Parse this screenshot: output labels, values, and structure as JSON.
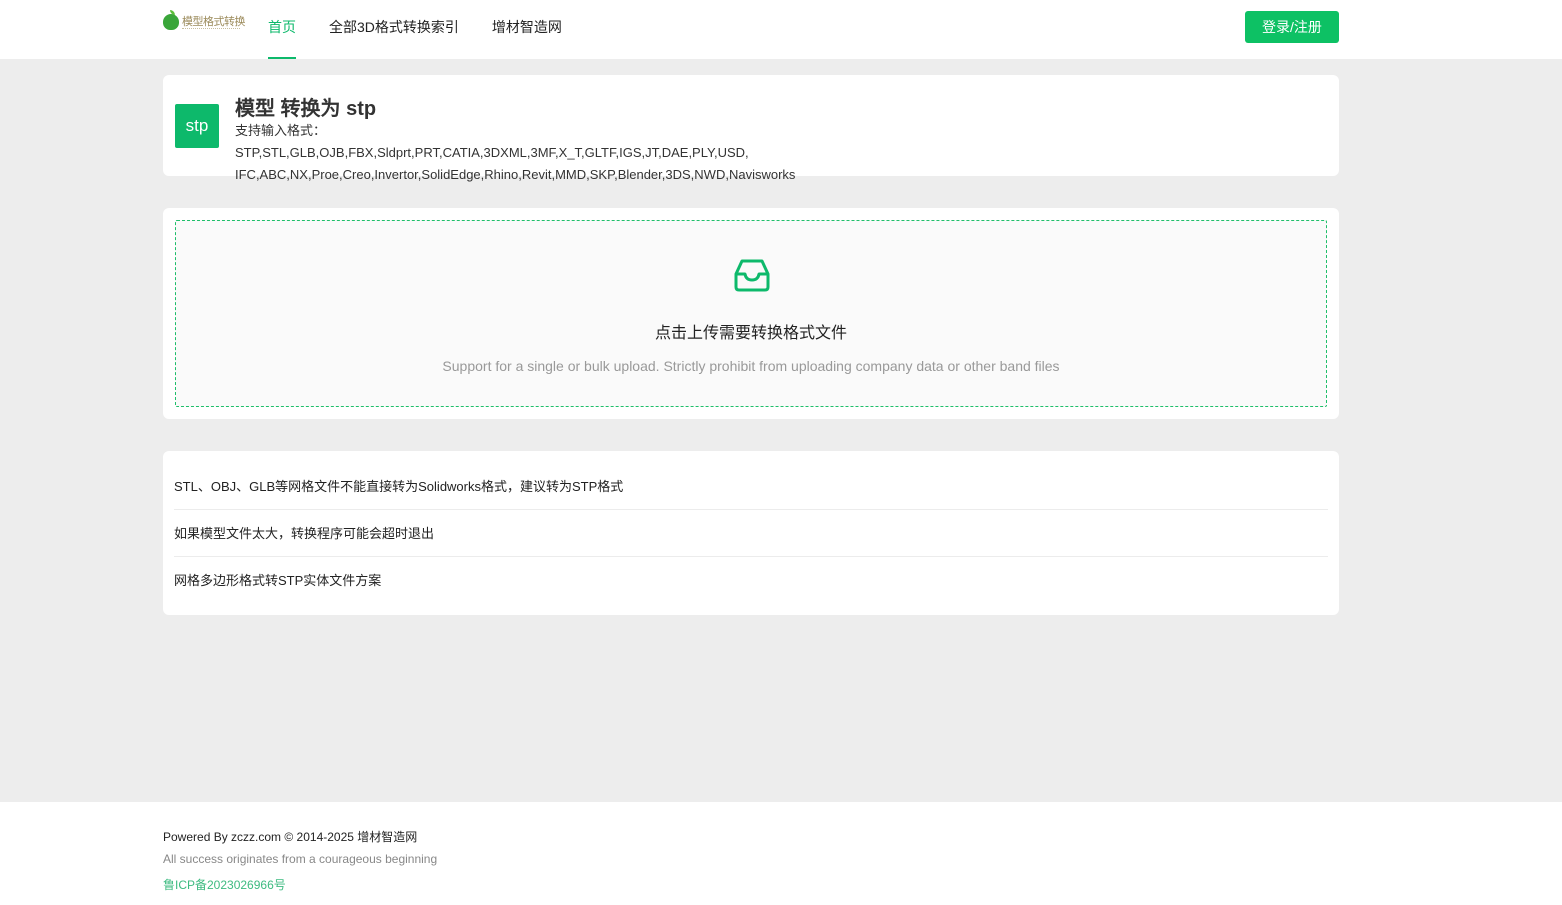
{
  "brand": {
    "logo_text": "模型格式转换"
  },
  "nav": {
    "items": [
      {
        "label": "首页",
        "active": true
      },
      {
        "label": "全部3D格式转换索引",
        "active": false
      },
      {
        "label": "增材智造网",
        "active": false
      }
    ]
  },
  "auth": {
    "login_label": "登录/注册"
  },
  "converter": {
    "badge": "stp",
    "title": "模型 转换为 stp",
    "supported_line1": "支持输入格式：STP,STL,GLB,OJB,FBX,Sldprt,PRT,CATIA,3DXML,3MF,X_T,GLTF,IGS,JT,DAE,PLY,USD,",
    "supported_line2": "IFC,ABC,NX,Proe,Creo,Invertor,SolidEdge,Rhino,Revit,MMD,SKP,Blender,3DS,NWD,Navisworks"
  },
  "upload": {
    "icon": "inbox-icon",
    "text": "点击上传需要转换格式文件",
    "hint": "Support for a single or bulk upload. Strictly prohibit from uploading company data or other band files",
    "accent": "#0db96b"
  },
  "tips": [
    "STL、OBJ、GLB等网格文件不能直接转为Solidworks格式，建议转为STP格式",
    "如果模型文件太大，转换程序可能会超时退出",
    "网格多边形格式转STP实体文件方案"
  ],
  "footer": {
    "powered": "Powered By zczz.com © 2014-2025 增材智造网",
    "slogan": "All success originates from a courageous beginning",
    "icp": "鲁ICP备2023026966号"
  }
}
